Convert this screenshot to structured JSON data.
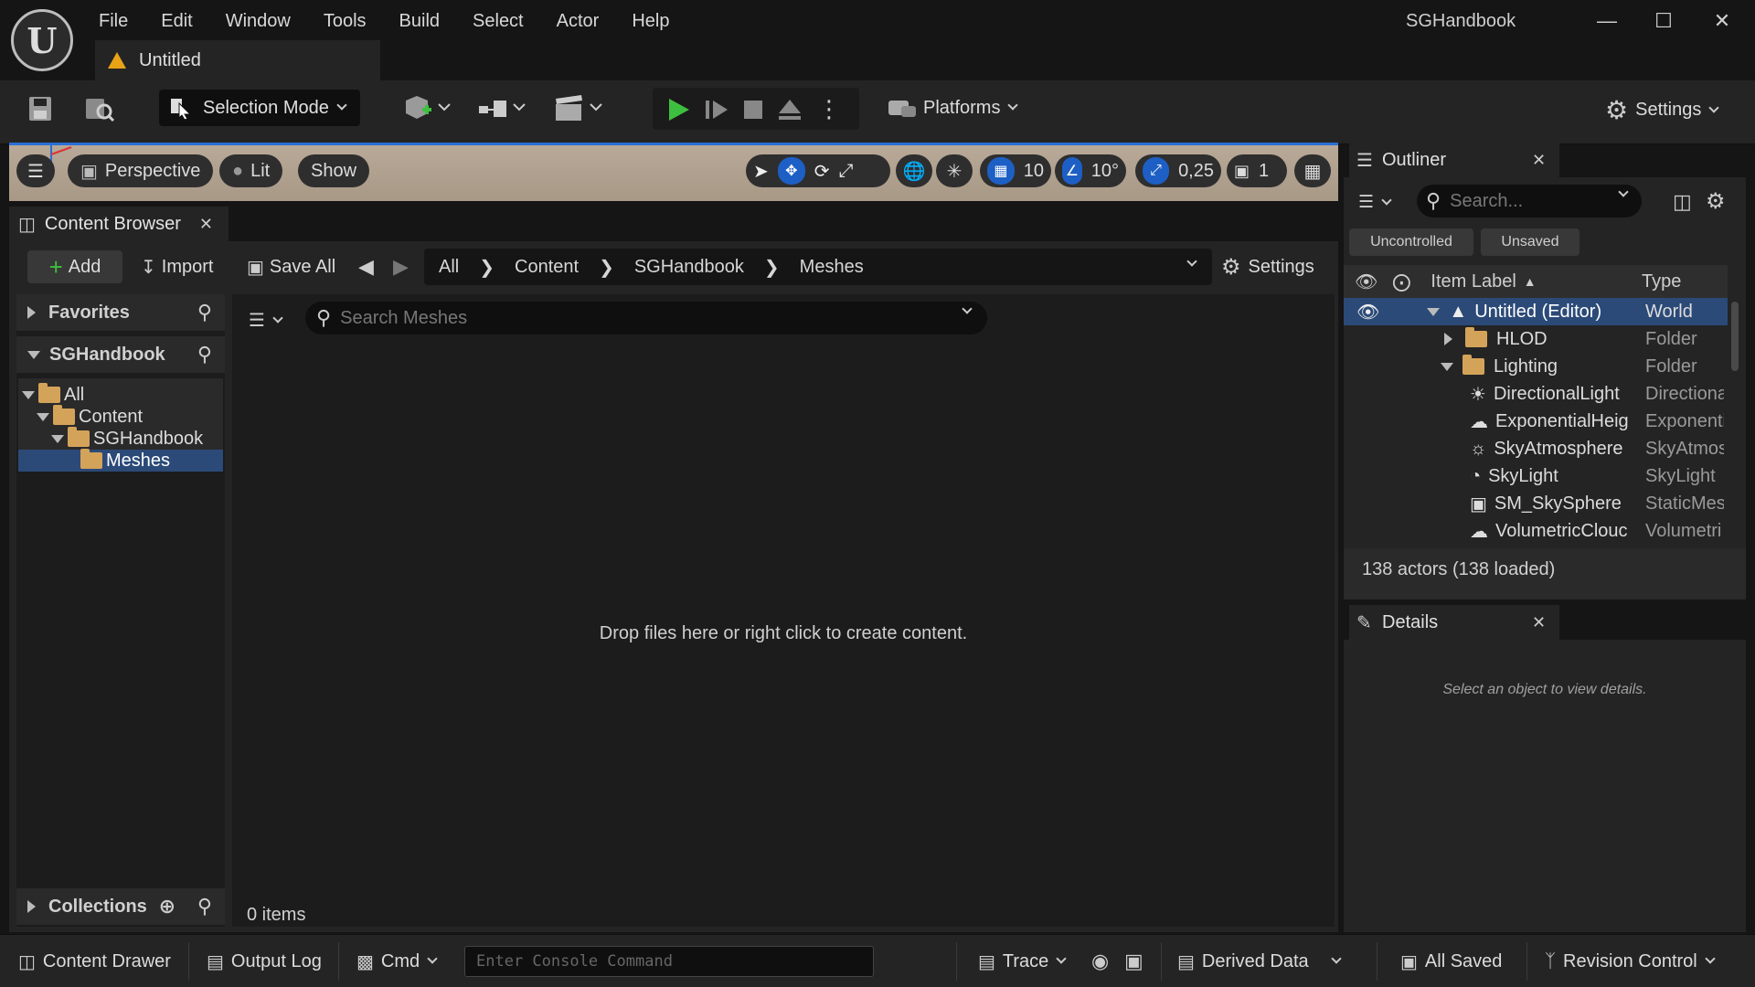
{
  "app": {
    "name": "SGHandbook",
    "menu": [
      "File",
      "Edit",
      "Window",
      "Tools",
      "Build",
      "Select",
      "Actor",
      "Help"
    ],
    "document_tab": "Untitled",
    "logo_glyph": "U"
  },
  "toolbar": {
    "selection_mode": "Selection Mode",
    "platforms": "Platforms",
    "settings": "Settings"
  },
  "viewport": {
    "perspective": "Perspective",
    "lit": "Lit",
    "show": "Show",
    "grid_snap": "10",
    "rotation_snap": "10°",
    "scale_snap": "0,25",
    "camera_speed": "1"
  },
  "content_browser": {
    "tab": "Content Browser",
    "add": "Add",
    "import": "Import",
    "save_all": "Save All",
    "settings": "Settings",
    "breadcrumb": [
      "All",
      "Content",
      "SGHandbook",
      "Meshes"
    ],
    "favorites": "Favorites",
    "root": "SGHandbook",
    "tree": [
      "All",
      "Content",
      "SGHandbook",
      "Meshes"
    ],
    "search_placeholder": "Search Meshes",
    "empty_message": "Drop files here or right click to create content.",
    "item_count": "0 items",
    "collections": "Collections"
  },
  "outliner": {
    "tab": "Outliner",
    "search_placeholder": "Search...",
    "chips": [
      "Uncontrolled",
      "Unsaved"
    ],
    "col_label": "Item Label",
    "col_type": "Type",
    "rows": [
      {
        "label": "Untitled (Editor)",
        "type": "World"
      },
      {
        "label": "HLOD",
        "type": "Folder"
      },
      {
        "label": "Lighting",
        "type": "Folder"
      },
      {
        "label": "DirectionalLight",
        "type": "Directiona"
      },
      {
        "label": "ExponentialHeig",
        "type": "Exponenti"
      },
      {
        "label": "SkyAtmosphere",
        "type": "SkyAtmos"
      },
      {
        "label": "SkyLight",
        "type": "SkyLight"
      },
      {
        "label": "SM_SkySphere",
        "type": "StaticMes"
      },
      {
        "label": "VolumetricClouc",
        "type": "Volumetri"
      }
    ],
    "actor_count": "138 actors (138 loaded)"
  },
  "details": {
    "tab": "Details",
    "empty": "Select an object to view details."
  },
  "statusbar": {
    "content_drawer": "Content Drawer",
    "output_log": "Output Log",
    "cmd": "Cmd",
    "console_placeholder": "Enter Console Command",
    "trace": "Trace",
    "derived_data": "Derived Data",
    "all_saved": "All Saved",
    "revision_control": "Revision Control"
  },
  "colors": {
    "accent_blue": "#1d5fc4",
    "play_green": "#3fbf3f",
    "folder": "#d4a35a",
    "warning": "#e8a317",
    "selection": "#2b4a78"
  }
}
